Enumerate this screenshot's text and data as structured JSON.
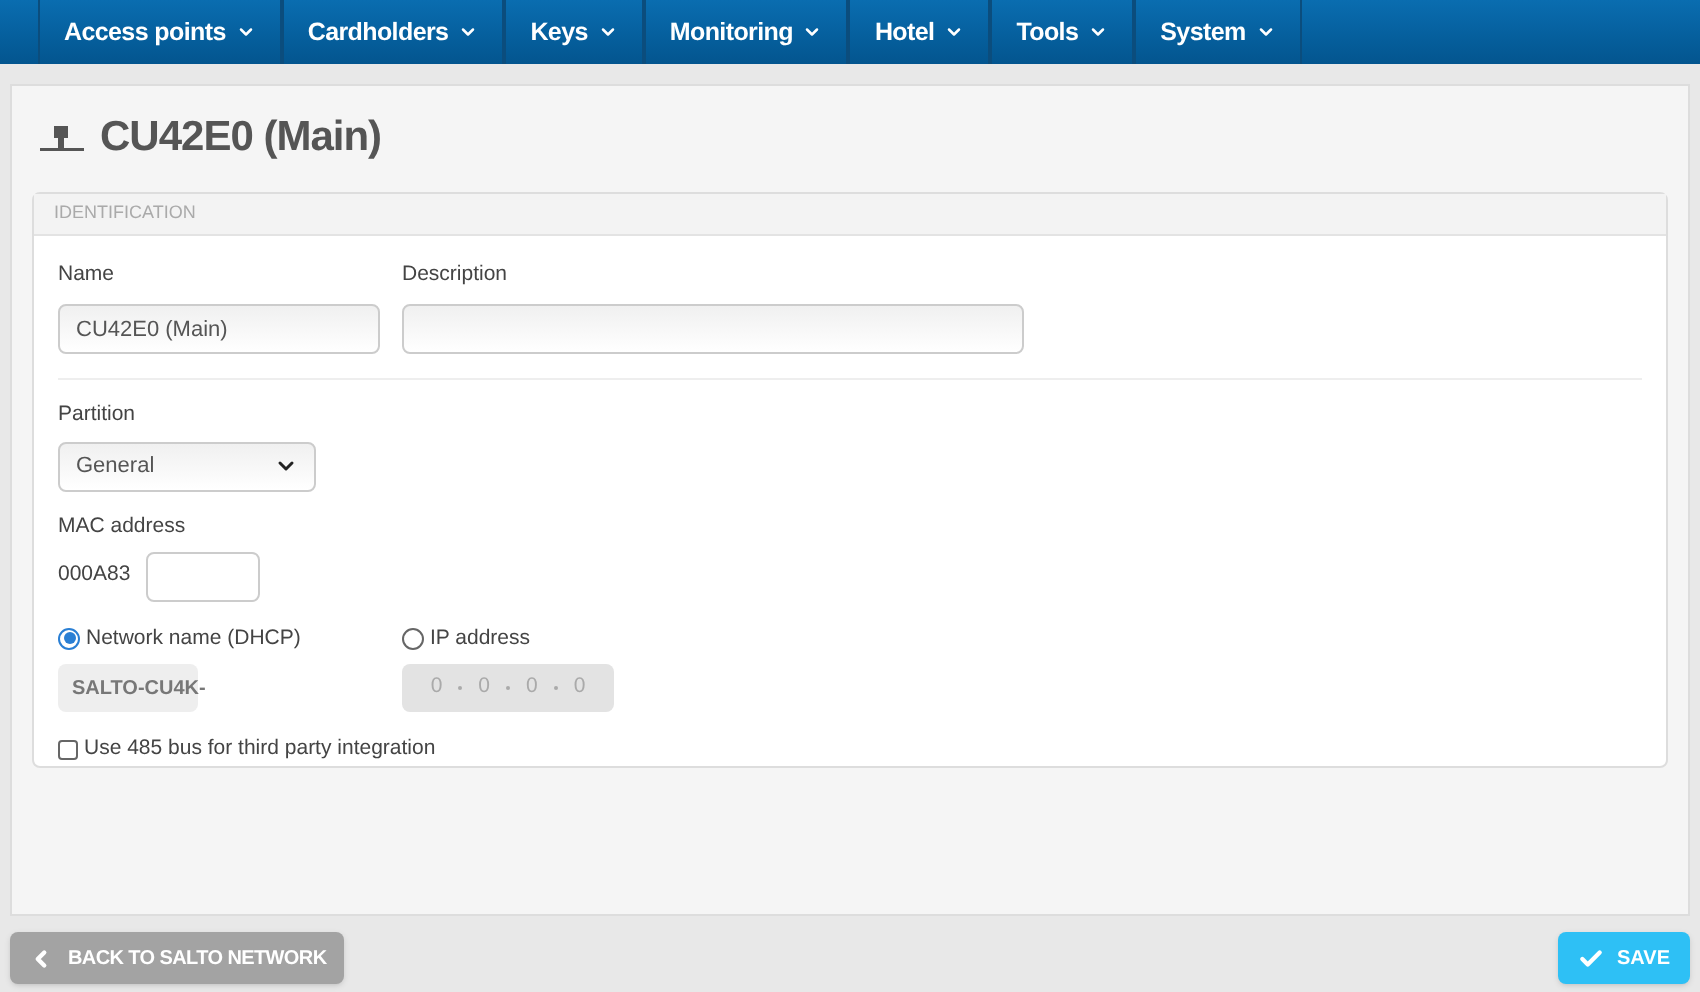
{
  "nav": [
    {
      "label": "Access points"
    },
    {
      "label": "Cardholders"
    },
    {
      "label": "Keys"
    },
    {
      "label": "Monitoring"
    },
    {
      "label": "Hotel"
    },
    {
      "label": "Tools"
    },
    {
      "label": "System"
    }
  ],
  "page": {
    "title": "CU42E0 (Main)"
  },
  "section": {
    "title": "IDENTIFICATION",
    "name": {
      "label": "Name",
      "value": "CU42E0 (Main)"
    },
    "description": {
      "label": "Description"
    },
    "partition": {
      "label": "Partition",
      "value": "General"
    },
    "mac": {
      "label": "MAC address",
      "prefix": "000A83"
    },
    "network_name": {
      "label": "Network name (DHCP)",
      "selected": true,
      "value": "SALTO-CU4K-"
    },
    "ip_address": {
      "label": "IP address",
      "selected": false,
      "octets": [
        "0",
        "0",
        "0",
        "0"
      ]
    },
    "bus485": {
      "label": "Use 485 bus for third party integration",
      "checked": false
    }
  },
  "footer": {
    "back": "BACK TO SALTO NETWORK",
    "save": "SAVE"
  }
}
